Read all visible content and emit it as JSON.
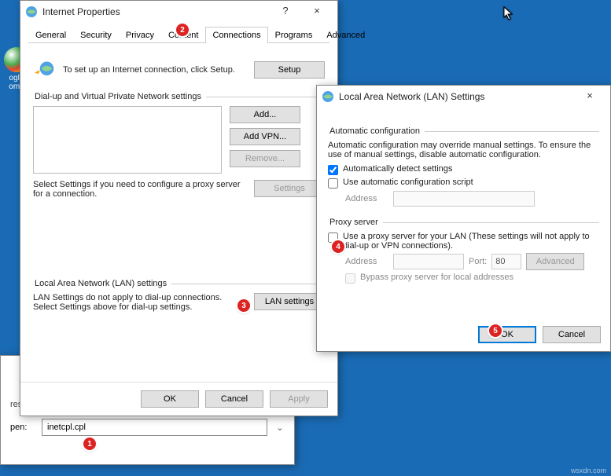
{
  "desktop": {
    "chrome_label": "ogle\nome"
  },
  "internet_props": {
    "title": "Internet Properties",
    "help_btn": "?",
    "close_btn": "×",
    "tabs": [
      "General",
      "Security",
      "Privacy",
      "Content",
      "Connections",
      "Programs",
      "Advanced"
    ],
    "active_tab": 4,
    "setup_text": "To set up an Internet connection, click Setup.",
    "setup_btn": "Setup",
    "dialup_legend": "Dial-up and Virtual Private Network settings",
    "add_btn": "Add...",
    "addvpn_btn": "Add VPN...",
    "remove_btn": "Remove...",
    "settings_btn": "Settings",
    "settings_text": "Select Settings if you need to configure a proxy server for a connection.",
    "lan_legend": "Local Area Network (LAN) settings",
    "lan_text": "LAN Settings do not apply to dial-up connections. Select Settings above for dial-up settings.",
    "lan_btn": "LAN settings",
    "ok": "OK",
    "cancel": "Cancel",
    "apply": "Apply"
  },
  "lan": {
    "title": "Local Area Network (LAN) Settings",
    "close_btn": "×",
    "auto_legend": "Automatic configuration",
    "auto_desc": "Automatic configuration may override manual settings.  To ensure the use of manual settings, disable automatic configuration.",
    "auto_detect": "Automatically detect settings",
    "auto_script": "Use automatic configuration script",
    "address_label": "Address",
    "proxy_legend": "Proxy server",
    "proxy_use": "Use a proxy server for your LAN (These settings will not apply to dial-up or VPN connections).",
    "port_label": "Port:",
    "port_value": "80",
    "advanced_btn": "Advanced",
    "bypass": "Bypass proxy server for local addresses",
    "ok": "OK",
    "cancel": "Cancel"
  },
  "run": {
    "hint": "resource, and Windows will open it for you.",
    "open_label": "pen:",
    "value": "inetcpl.cpl"
  },
  "markers": {
    "m1": "1",
    "m2": "2",
    "m3": "3",
    "m4": "4",
    "m5": "5"
  },
  "credit": "wsxdn.com"
}
